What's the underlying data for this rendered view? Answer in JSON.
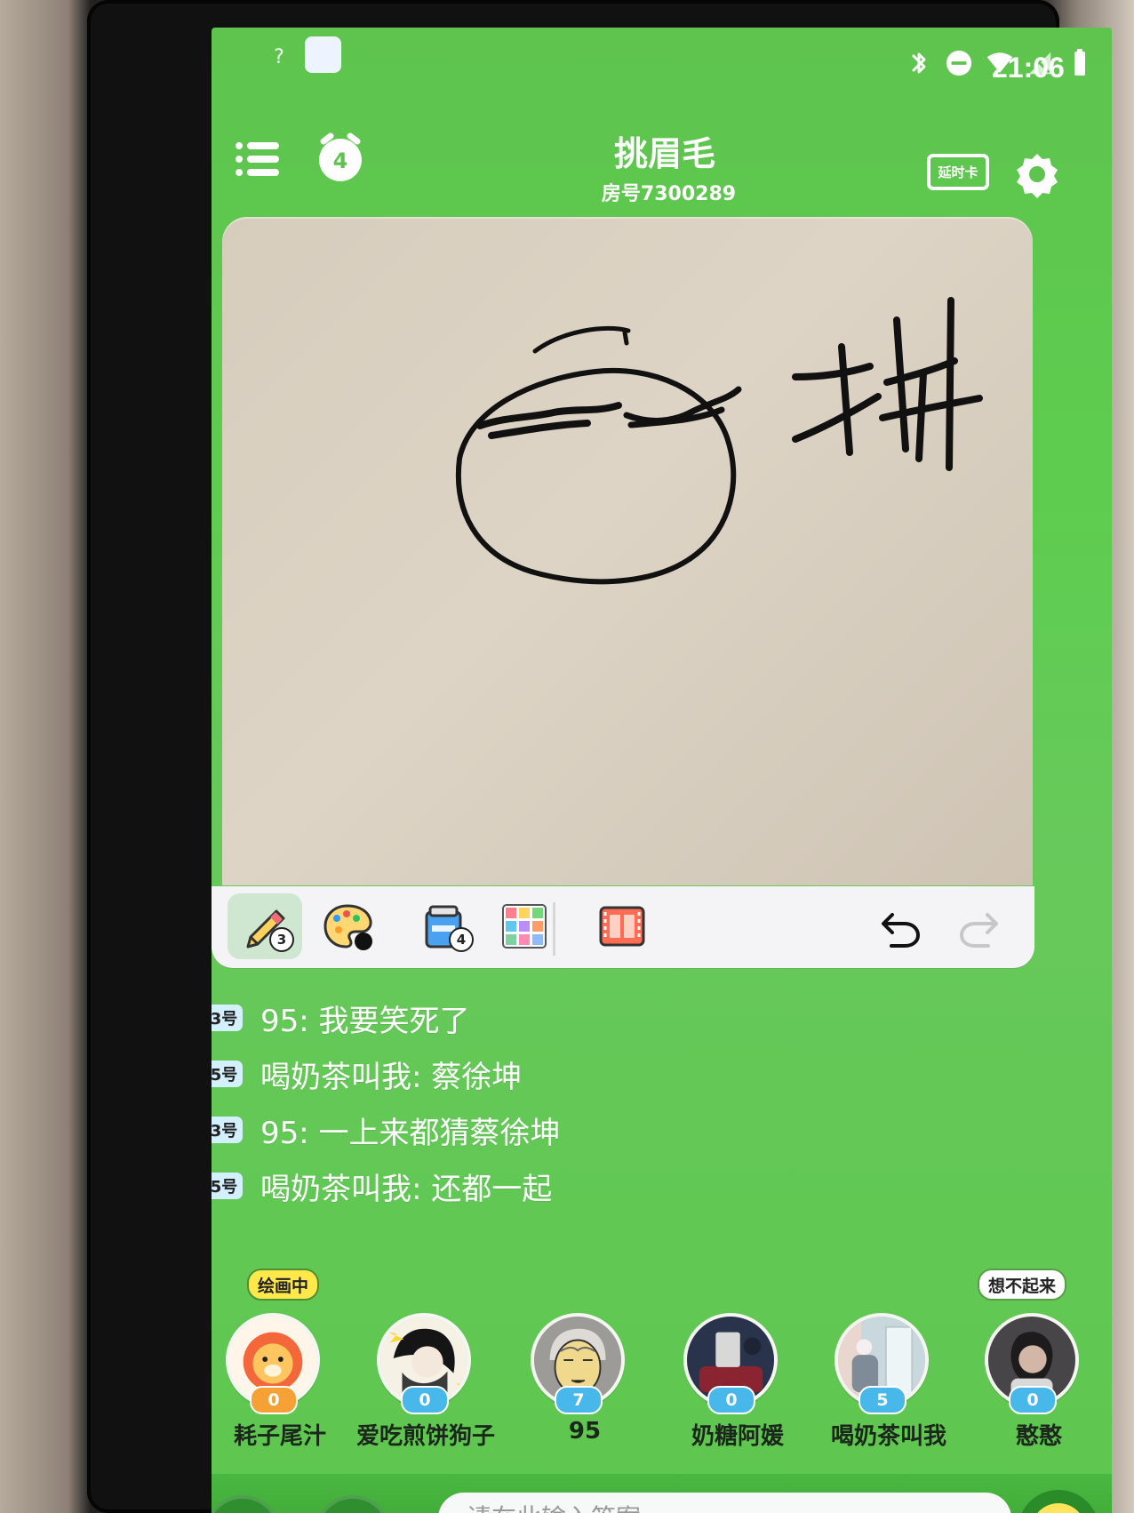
{
  "status_bar": {
    "wifi_question": "?",
    "time": "21:06"
  },
  "header": {
    "title": "挑眉毛",
    "room": "房号7300289",
    "alarm_count": "4",
    "card_label": "延时卡"
  },
  "toolbar": {
    "pencil_count": "3",
    "eraser_count": "4"
  },
  "chat": [
    {
      "seat": "3号",
      "text": "95: 我要笑死了"
    },
    {
      "seat": "5号",
      "text": "喝奶茶叫我: 蔡徐坤"
    },
    {
      "seat": "3号",
      "text": "95: 一上来都猜蔡徐坤"
    },
    {
      "seat": "5号",
      "text": "喝奶茶叫我: 还都一起"
    }
  ],
  "players": [
    {
      "name": "耗子尾汁",
      "score": "0",
      "tag": "绘画中",
      "avatar": "lion-avatar"
    },
    {
      "name": "爱吃煎饼狗子",
      "score": "0",
      "tag": "",
      "avatar": "anime-avatar"
    },
    {
      "name": "95",
      "score": "7",
      "tag": "",
      "avatar": "elder-avatar"
    },
    {
      "name": "奶糖阿媛",
      "score": "0",
      "tag": "",
      "avatar": "photo-avatar"
    },
    {
      "name": "喝奶茶叫我",
      "score": "5",
      "tag": "",
      "avatar": "photo-avatar"
    },
    {
      "name": "憨憨",
      "score": "0",
      "tag": "想不起来",
      "avatar": "photo-avatar"
    }
  ],
  "input": {
    "placeholder": "请在此输入答案"
  },
  "colors": {
    "screen_green": "#5ec44e",
    "toolbar_bg": "#f4f4f6",
    "score_blue": "#48b8eb",
    "score_orange": "#f5a135"
  }
}
